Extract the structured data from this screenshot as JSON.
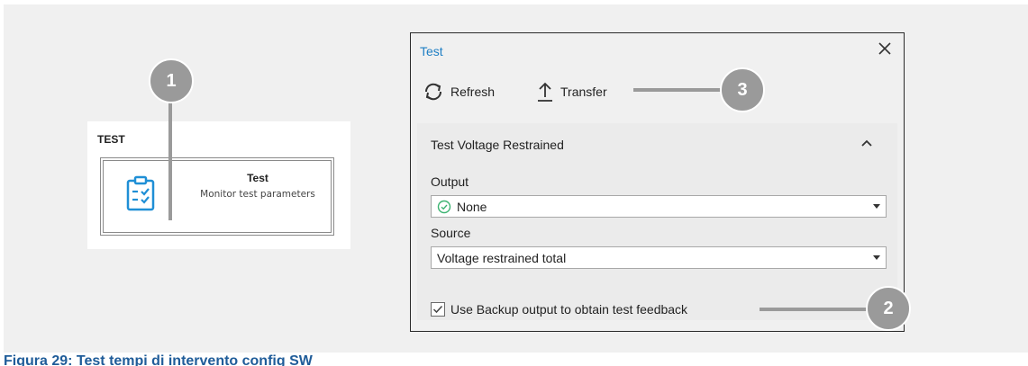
{
  "tile": {
    "heading": "TEST",
    "title": "Test",
    "subtitle": "Monitor test parameters",
    "icon": "clipboard-checklist-icon"
  },
  "dialog": {
    "title": "Test",
    "toolbar": {
      "refresh_label": "Refresh",
      "transfer_label": "Transfer"
    },
    "section": {
      "title": "Test Voltage Restrained",
      "expanded": true,
      "output": {
        "label": "Output",
        "value": "None",
        "status": "ok"
      },
      "source": {
        "label": "Source",
        "value": "Voltage restrained total"
      },
      "backup_checkbox": {
        "label": "Use Backup output to obtain test feedback",
        "checked": true
      }
    }
  },
  "callouts": [
    "1",
    "2",
    "3"
  ],
  "caption": "Figura 29: Test tempi di intervento config SW",
  "colors": {
    "accent": "#1f7fc4",
    "callout": "#9a9a9a",
    "caption": "#1f5c99",
    "ok": "#3cb371"
  }
}
